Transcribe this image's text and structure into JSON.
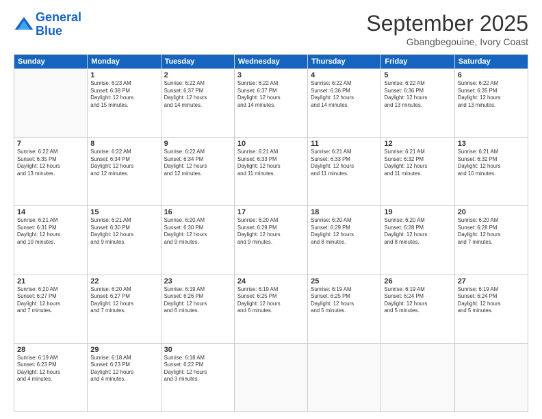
{
  "header": {
    "logo_line1": "General",
    "logo_line2": "Blue",
    "month": "September 2025",
    "location": "Gbangbegouine, Ivory Coast"
  },
  "weekdays": [
    "Sunday",
    "Monday",
    "Tuesday",
    "Wednesday",
    "Thursday",
    "Friday",
    "Saturday"
  ],
  "weeks": [
    [
      {
        "day": "",
        "info": ""
      },
      {
        "day": "1",
        "info": "Sunrise: 6:23 AM\nSunset: 6:38 PM\nDaylight: 12 hours\nand 15 minutes."
      },
      {
        "day": "2",
        "info": "Sunrise: 6:22 AM\nSunset: 6:37 PM\nDaylight: 12 hours\nand 14 minutes."
      },
      {
        "day": "3",
        "info": "Sunrise: 6:22 AM\nSunset: 6:37 PM\nDaylight: 12 hours\nand 14 minutes."
      },
      {
        "day": "4",
        "info": "Sunrise: 6:22 AM\nSunset: 6:36 PM\nDaylight: 12 hours\nand 14 minutes."
      },
      {
        "day": "5",
        "info": "Sunrise: 6:22 AM\nSunset: 6:36 PM\nDaylight: 12 hours\nand 13 minutes."
      },
      {
        "day": "6",
        "info": "Sunrise: 6:22 AM\nSunset: 6:35 PM\nDaylight: 12 hours\nand 13 minutes."
      }
    ],
    [
      {
        "day": "7",
        "info": "Sunrise: 6:22 AM\nSunset: 6:35 PM\nDaylight: 12 hours\nand 13 minutes."
      },
      {
        "day": "8",
        "info": "Sunrise: 6:22 AM\nSunset: 6:34 PM\nDaylight: 12 hours\nand 12 minutes."
      },
      {
        "day": "9",
        "info": "Sunrise: 6:22 AM\nSunset: 6:34 PM\nDaylight: 12 hours\nand 12 minutes."
      },
      {
        "day": "10",
        "info": "Sunrise: 6:21 AM\nSunset: 6:33 PM\nDaylight: 12 hours\nand 11 minutes."
      },
      {
        "day": "11",
        "info": "Sunrise: 6:21 AM\nSunset: 6:33 PM\nDaylight: 12 hours\nand 11 minutes."
      },
      {
        "day": "12",
        "info": "Sunrise: 6:21 AM\nSunset: 6:32 PM\nDaylight: 12 hours\nand 11 minutes."
      },
      {
        "day": "13",
        "info": "Sunrise: 6:21 AM\nSunset: 6:32 PM\nDaylight: 12 hours\nand 10 minutes."
      }
    ],
    [
      {
        "day": "14",
        "info": "Sunrise: 6:21 AM\nSunset: 6:31 PM\nDaylight: 12 hours\nand 10 minutes."
      },
      {
        "day": "15",
        "info": "Sunrise: 6:21 AM\nSunset: 6:30 PM\nDaylight: 12 hours\nand 9 minutes."
      },
      {
        "day": "16",
        "info": "Sunrise: 6:20 AM\nSunset: 6:30 PM\nDaylight: 12 hours\nand 9 minutes."
      },
      {
        "day": "17",
        "info": "Sunrise: 6:20 AM\nSunset: 6:29 PM\nDaylight: 12 hours\nand 9 minutes."
      },
      {
        "day": "18",
        "info": "Sunrise: 6:20 AM\nSunset: 6:29 PM\nDaylight: 12 hours\nand 8 minutes."
      },
      {
        "day": "19",
        "info": "Sunrise: 6:20 AM\nSunset: 6:28 PM\nDaylight: 12 hours\nand 8 minutes."
      },
      {
        "day": "20",
        "info": "Sunrise: 6:20 AM\nSunset: 6:28 PM\nDaylight: 12 hours\nand 7 minutes."
      }
    ],
    [
      {
        "day": "21",
        "info": "Sunrise: 6:20 AM\nSunset: 6:27 PM\nDaylight: 12 hours\nand 7 minutes."
      },
      {
        "day": "22",
        "info": "Sunrise: 6:20 AM\nSunset: 6:27 PM\nDaylight: 12 hours\nand 7 minutes."
      },
      {
        "day": "23",
        "info": "Sunrise: 6:19 AM\nSunset: 6:26 PM\nDaylight: 12 hours\nand 6 minutes."
      },
      {
        "day": "24",
        "info": "Sunrise: 6:19 AM\nSunset: 6:25 PM\nDaylight: 12 hours\nand 6 minutes."
      },
      {
        "day": "25",
        "info": "Sunrise: 6:19 AM\nSunset: 6:25 PM\nDaylight: 12 hours\nand 5 minutes."
      },
      {
        "day": "26",
        "info": "Sunrise: 6:19 AM\nSunset: 6:24 PM\nDaylight: 12 hours\nand 5 minutes."
      },
      {
        "day": "27",
        "info": "Sunrise: 6:19 AM\nSunset: 6:24 PM\nDaylight: 12 hours\nand 5 minutes."
      }
    ],
    [
      {
        "day": "28",
        "info": "Sunrise: 6:19 AM\nSunset: 6:23 PM\nDaylight: 12 hours\nand 4 minutes."
      },
      {
        "day": "29",
        "info": "Sunrise: 6:18 AM\nSunset: 6:23 PM\nDaylight: 12 hours\nand 4 minutes."
      },
      {
        "day": "30",
        "info": "Sunrise: 6:18 AM\nSunset: 6:22 PM\nDaylight: 12 hours\nand 3 minutes."
      },
      {
        "day": "",
        "info": ""
      },
      {
        "day": "",
        "info": ""
      },
      {
        "day": "",
        "info": ""
      },
      {
        "day": "",
        "info": ""
      }
    ]
  ]
}
